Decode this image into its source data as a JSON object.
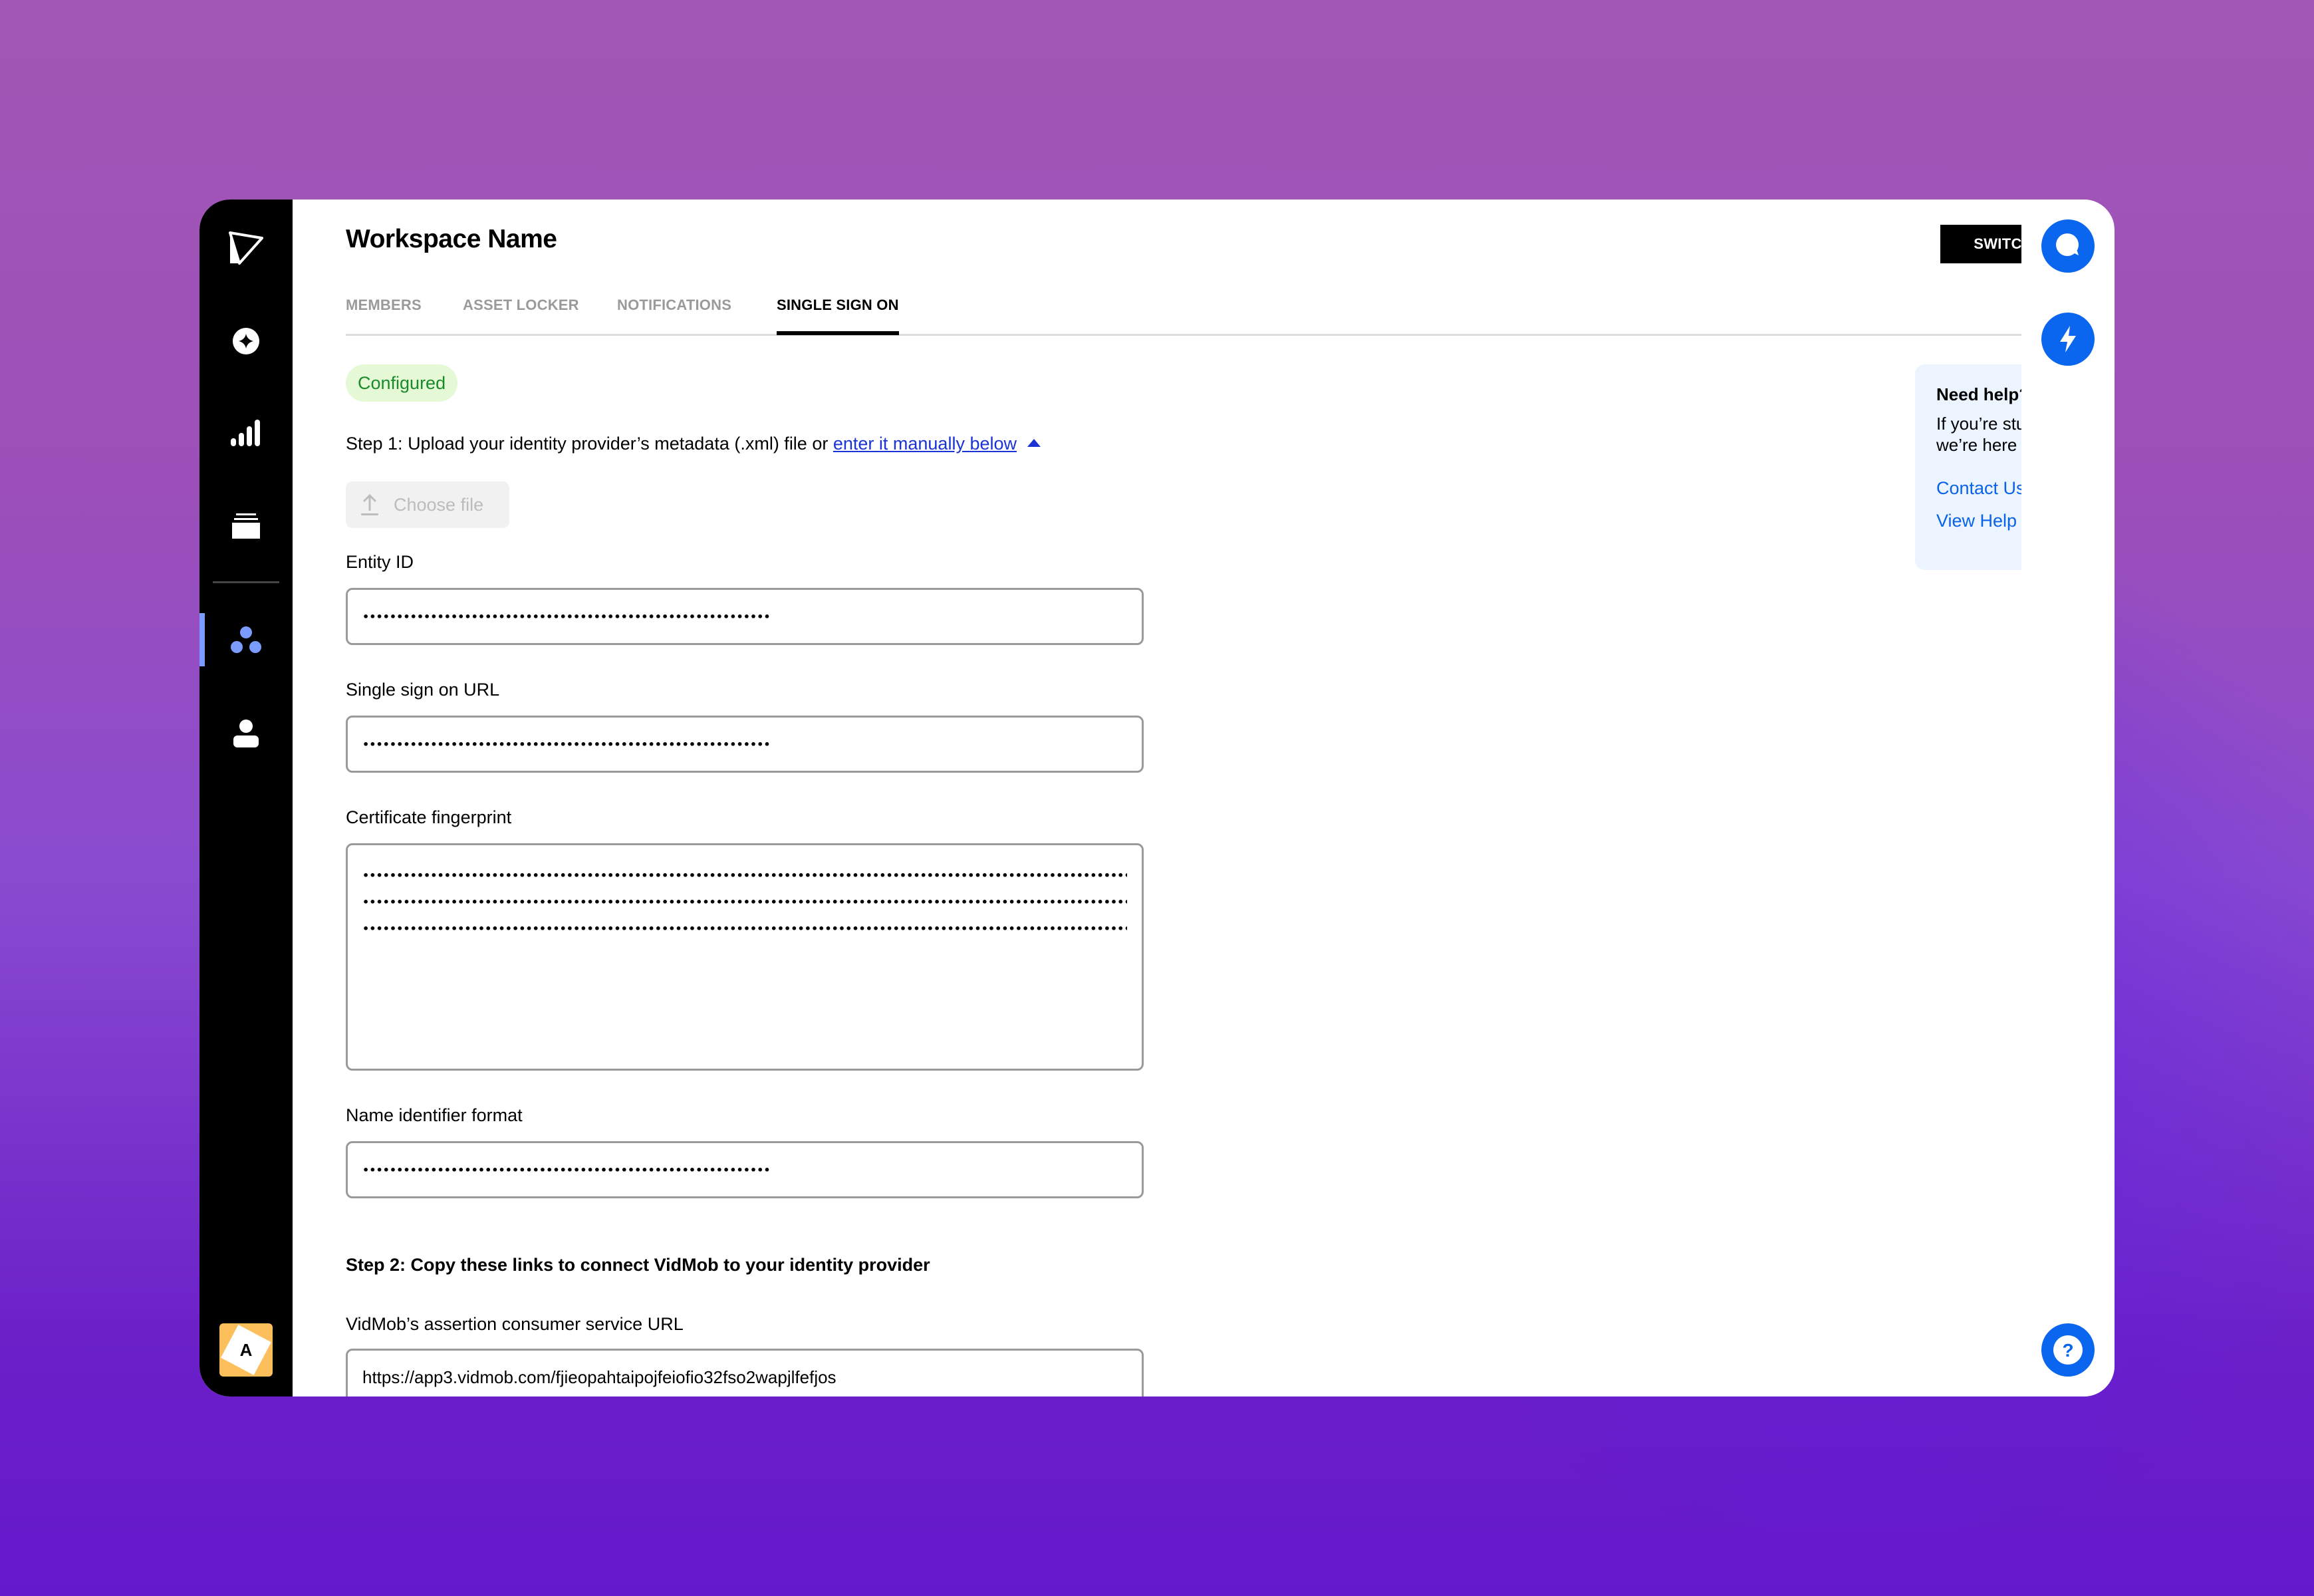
{
  "header": {
    "title": "Workspace Name",
    "switch_workspace_label": "SWITCH WORKSPACE"
  },
  "tabs": [
    {
      "label": "MEMBERS",
      "active": false
    },
    {
      "label": "ASSET LOCKER",
      "active": false
    },
    {
      "label": "NOTIFICATIONS",
      "active": false
    },
    {
      "label": "SINGLE SIGN ON",
      "active": true
    }
  ],
  "sidebar": {
    "items": [
      {
        "icon": "logo-icon"
      },
      {
        "icon": "sparkle-icon"
      },
      {
        "icon": "analytics-bars-icon"
      },
      {
        "icon": "stack-icon"
      },
      {
        "icon": "workspace-icon",
        "active": true
      },
      {
        "icon": "user-icon"
      }
    ],
    "avatar_letter": "A",
    "active_color": "#7b9bff"
  },
  "status_badge": "Configured",
  "step1": {
    "text": "Step 1: Upload your identity provider’s metadata (.xml) file or ",
    "link": "enter it manually below"
  },
  "choose_file_label": "Choose file",
  "fields": {
    "entity_id": {
      "label": "Entity ID",
      "value": "••••••••••••••••••••••••••••••••••••••••••••••••••••••••••••"
    },
    "sso_url": {
      "label": "Single sign on URL",
      "value": "••••••••••••••••••••••••••••••••••••••••••••••••••••••••••••"
    },
    "certificate": {
      "label": "Certificate fingerprint",
      "lines": [
        "•••••••••••••••••••••••••••••••••••••••••••••••••••••••••••••••••••••••••••••••••••••••••••••••••••••••••••••••••••",
        "•••••••••••••••••••••••••••••••••••••••••••••••••••••••••••••••••••••••••••••••••••••••••••••••••••••••••••••••••••",
        "•••••••••••••••••••••••••••••••••••••••••••••••••••••••••••••••••••••••••••••••••••••••••••••••••••••••••••••••••••"
      ]
    },
    "name_id_format": {
      "label": "Name identifier format",
      "value": "••••••••••••••••••••••••••••••••••••••••••••••••••••••••••••"
    }
  },
  "step2": {
    "text": "Step 2: Copy these links to connect VidMob to your identity provider",
    "acs_url": {
      "label": "VidMob’s assertion consumer service URL",
      "value": "https://app3.vidmob.com/fjieopahtaipojfeiofio32fso2wapjlfefjos"
    }
  },
  "help": {
    "title": "Need help?",
    "body": "If you’re stuck at any point, we’re here to help.",
    "links": [
      "Contact Us",
      "View Help Center"
    ]
  },
  "rail": {
    "buttons": [
      "chat-icon",
      "lightning-icon",
      "help-icon"
    ],
    "color": "#0a66ee"
  }
}
